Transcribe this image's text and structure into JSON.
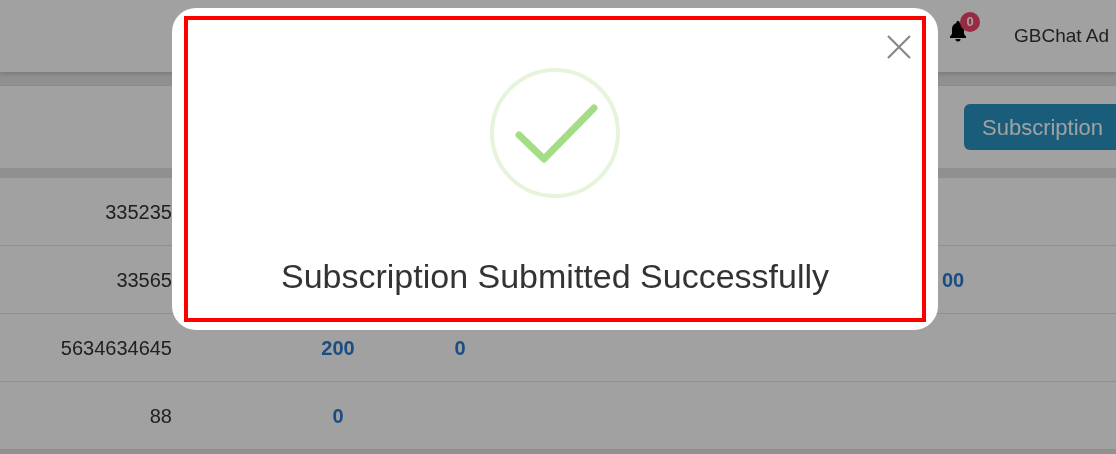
{
  "header": {
    "notification_count": "0",
    "user": "GBChat Ad"
  },
  "toolbar": {
    "button": "Subscription"
  },
  "table": {
    "rows": [
      {
        "column_1": "335235"
      },
      {
        "column_1": "33565",
        "column_4": "00"
      },
      {
        "column_1": "5634634645",
        "column_2": "200",
        "column_3": "0"
      },
      {
        "column_1": "88",
        "column_2": "0"
      }
    ]
  },
  "modal": {
    "message": "Subscription Submitted Successfully"
  }
}
